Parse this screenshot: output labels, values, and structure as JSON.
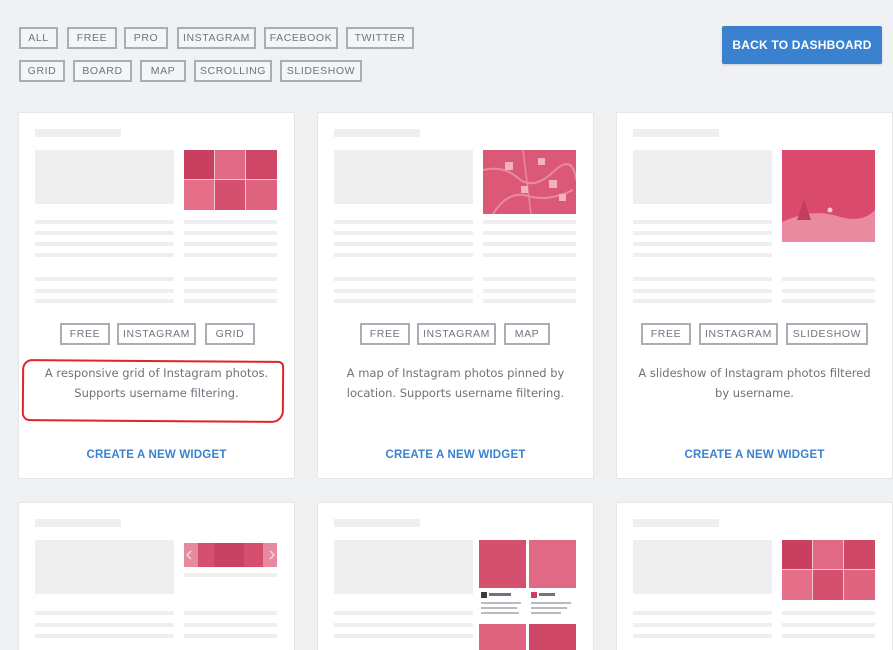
{
  "filters": {
    "row1": [
      "ALL",
      "FREE",
      "PRO",
      "INSTAGRAM",
      "FACEBOOK",
      "TWITTER"
    ],
    "row2": [
      "GRID",
      "BOARD",
      "MAP",
      "SCROLLING",
      "SLIDESHOW"
    ]
  },
  "back_button": "BACK TO DASHBOARD",
  "accent_color": "#3a82cf",
  "thumb_color": "#d84d6e",
  "widgets": [
    {
      "tags": [
        "FREE",
        "INSTAGRAM",
        "GRID"
      ],
      "description": "A responsive grid of Instagram photos. Supports username filtering.",
      "cta": "CREATE A NEW WIDGET"
    },
    {
      "tags": [
        "FREE",
        "INSTAGRAM",
        "MAP"
      ],
      "description": "A map of Instagram photos pinned by location. Supports username filtering.",
      "cta": "CREATE A NEW WIDGET"
    },
    {
      "tags": [
        "FREE",
        "INSTAGRAM",
        "SLIDESHOW"
      ],
      "description": "A slideshow of Instagram photos filtered by username.",
      "cta": "CREATE A NEW WIDGET"
    }
  ]
}
